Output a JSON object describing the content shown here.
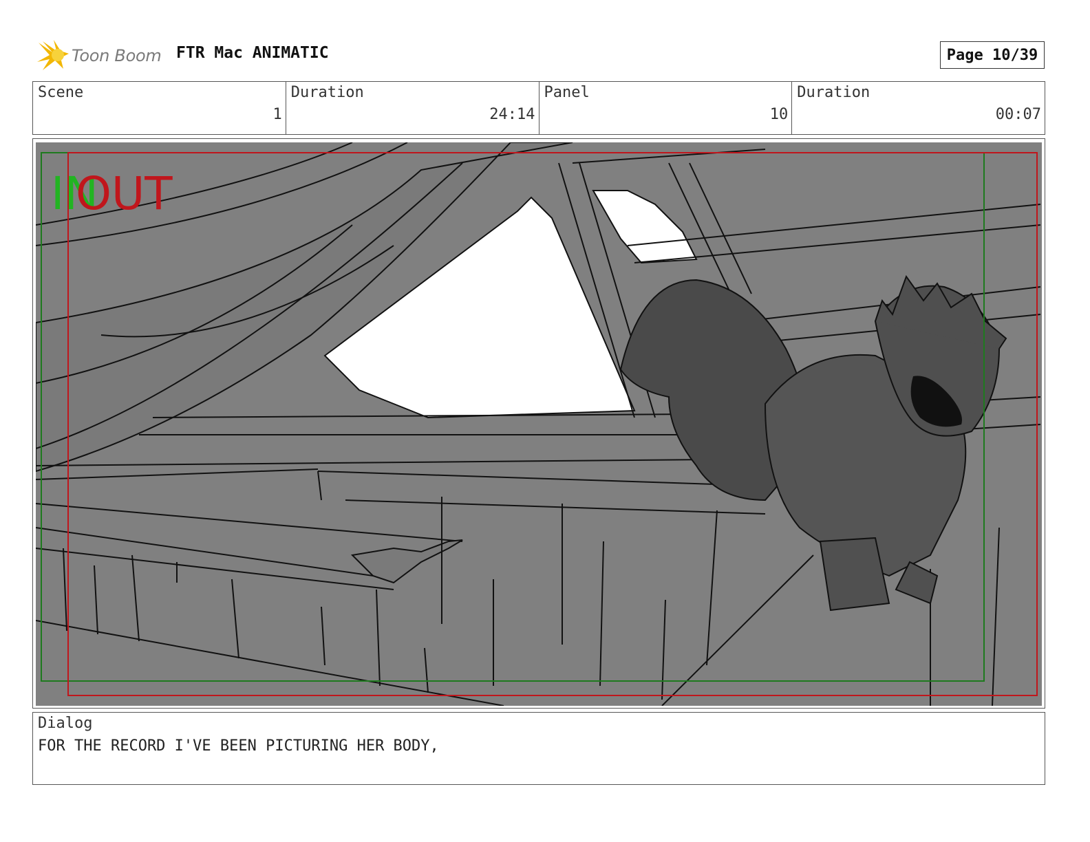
{
  "header": {
    "logo_text": "Toon Boom",
    "project_title": "FTR Mac ANIMATIC",
    "page_label": "Page 10/39"
  },
  "info": {
    "scene_label": "Scene",
    "scene_value": "1",
    "duration_label": "Duration",
    "duration_value": "24:14",
    "panel_label": "Panel",
    "panel_value": "10",
    "panel_duration_label": "Duration",
    "panel_duration_value": "00:07"
  },
  "frame": {
    "in_marker": "IN",
    "out_marker": "OUT",
    "colors": {
      "in_marker": "#22b422",
      "out_marker": "#c0161c",
      "safe_area_green": "#1e7a1e",
      "safe_area_red": "#c0161c",
      "background_gray": "#808080",
      "character_dark": "#4a4a4a"
    }
  },
  "dialog": {
    "label": "Dialog",
    "text": "FOR THE RECORD I'VE BEEN PICTURING HER BODY,"
  }
}
